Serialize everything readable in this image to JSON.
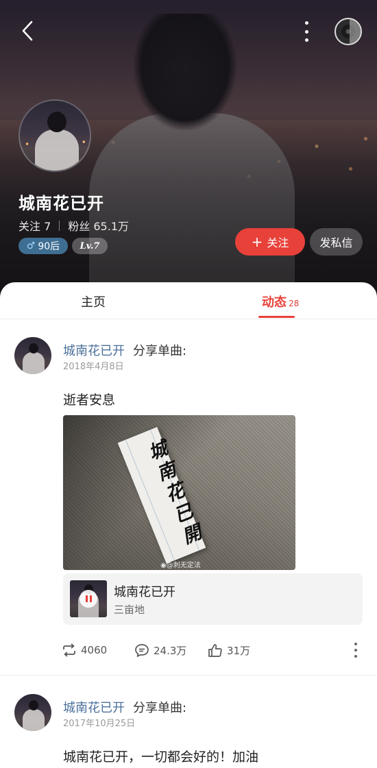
{
  "header": {
    "name": "城南花已开",
    "following_label": "关注 7",
    "fans_label": "粉丝 65.1万",
    "age_tag": "90后",
    "age_symbol": "♂",
    "level_tag": "Lv.7",
    "follow_button": "关注",
    "follow_plus": "+",
    "message_button": "发私信"
  },
  "tabs": {
    "home": "主页",
    "feed": "动态",
    "feed_count": "28"
  },
  "posts": [
    {
      "author": "城南花已开",
      "action": "分享单曲:",
      "date": "2018年4月8日",
      "text": "逝者安息",
      "image_handwriting": "城南花已開",
      "image_watermark": "◉@刺无定法",
      "song": {
        "title": "城南花已开",
        "artist": "三亩地"
      },
      "shares": "4060",
      "comments": "24.3万",
      "likes": "31万"
    },
    {
      "author": "城南花已开",
      "action": "分享单曲:",
      "date": "2017年10月25日",
      "text": "城南花已开，一切都会好的！加油"
    }
  ],
  "colors": {
    "accent": "#e8413a",
    "author_link": "#4a6f9a",
    "age_tag_bg": "#3f6e93"
  }
}
